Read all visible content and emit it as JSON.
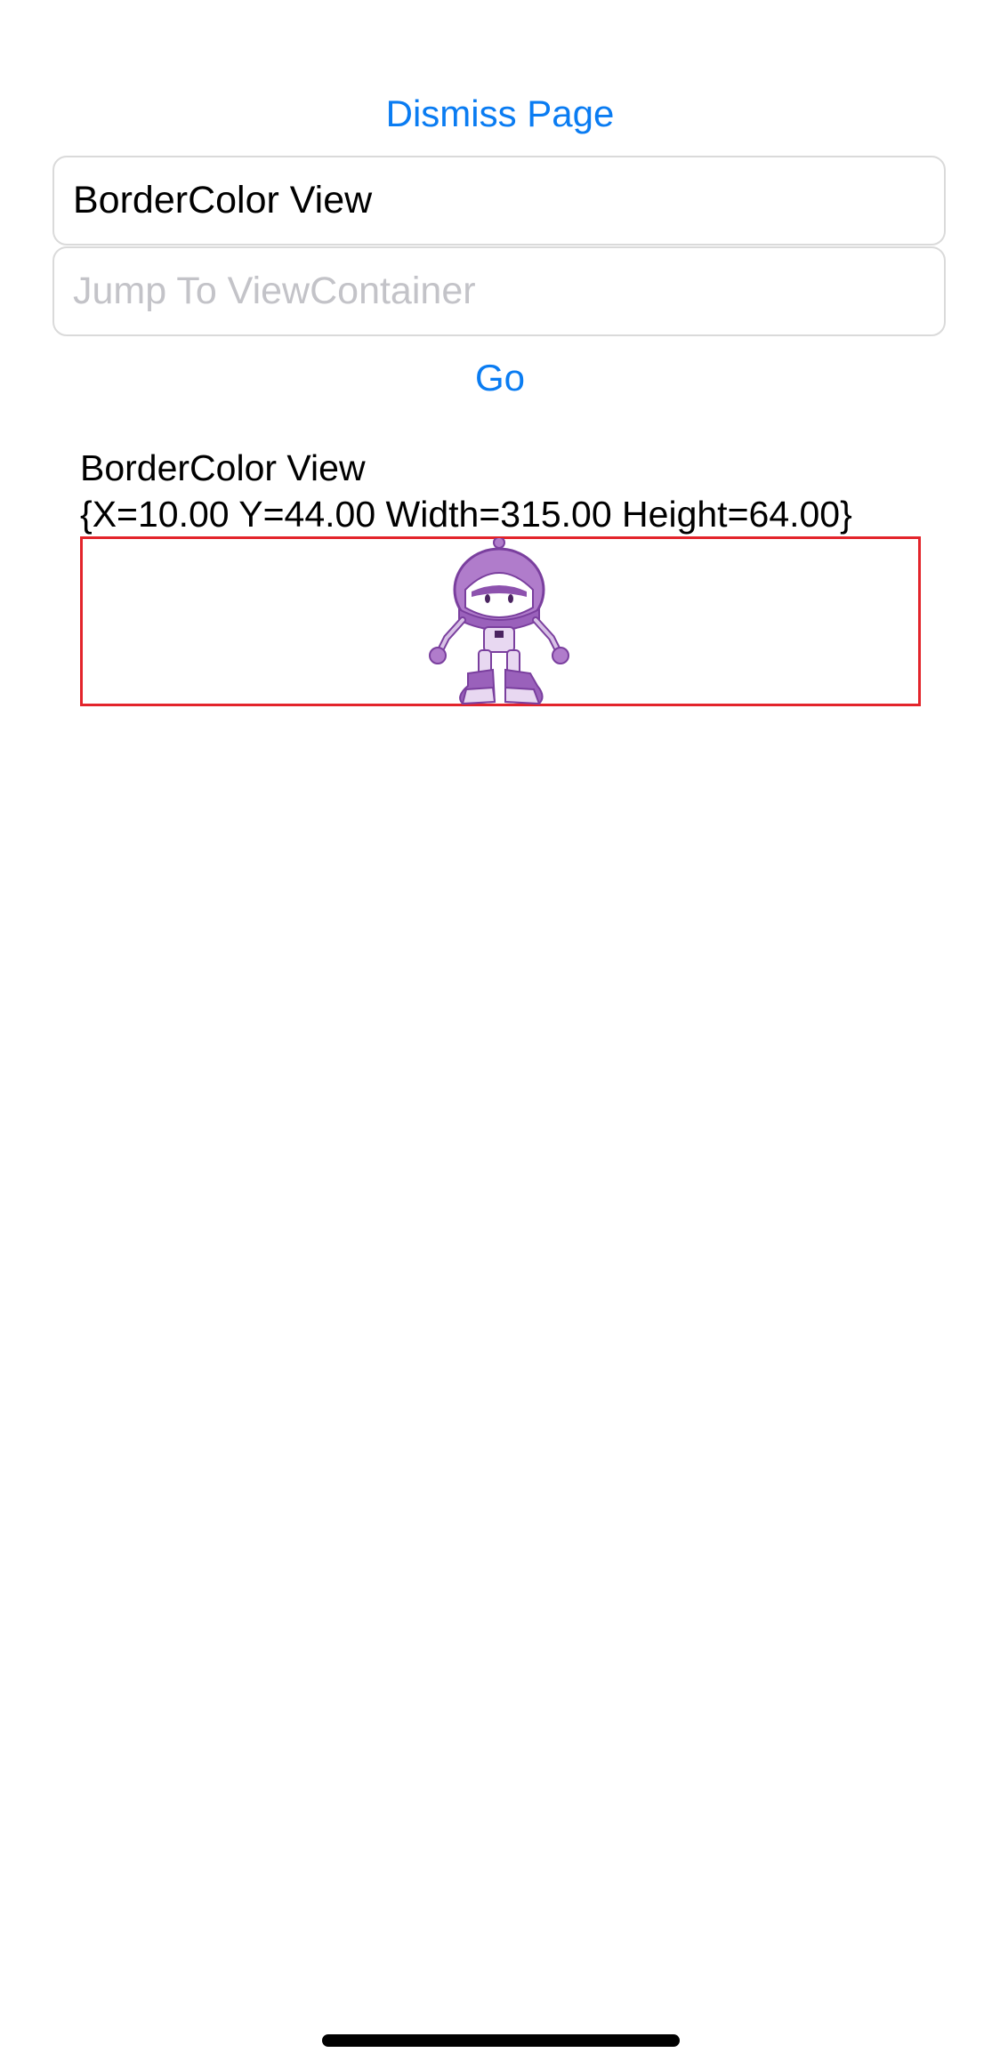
{
  "header": {
    "dismiss_label": "Dismiss Page"
  },
  "form": {
    "title_value": "BorderColor View",
    "jump_placeholder": "Jump To ViewContainer",
    "go_label": "Go"
  },
  "content": {
    "view_title": "BorderColor View",
    "view_frame": "{X=10.00 Y=44.00 Width=315.00 Height=64.00}",
    "border_color": "#e3242b",
    "image_icon": "robot-mascot-icon"
  },
  "theme": {
    "accent": "#0a7cf2",
    "placeholder": "#c3c3c8"
  }
}
